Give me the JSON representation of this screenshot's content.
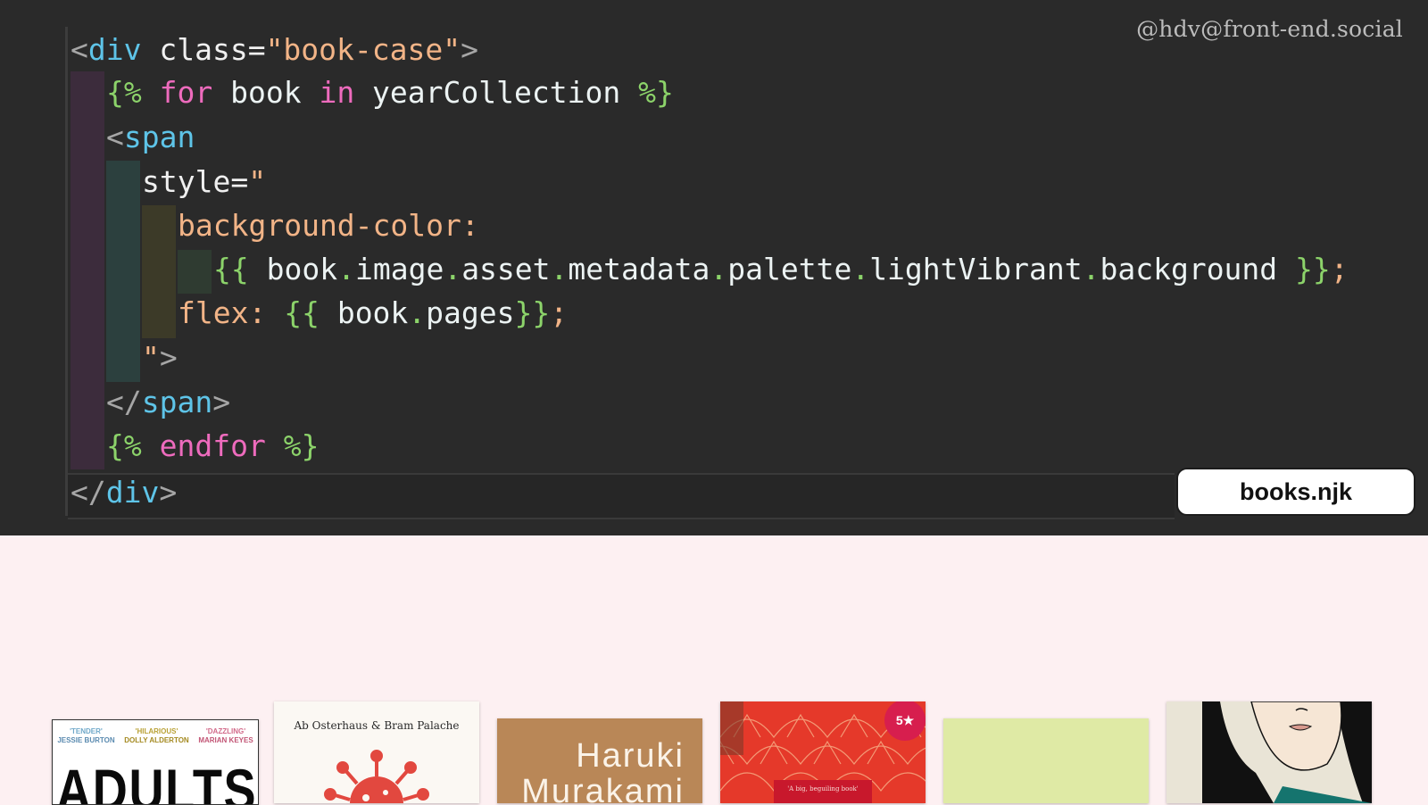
{
  "handle": "@hdv@front-end.social",
  "file_label": "books.njk",
  "code": {
    "l1": {
      "open": "<",
      "tag": "div",
      "attr": " class=",
      "val": "\"book-case\"",
      "close": ">"
    },
    "l2": {
      "open": "{%",
      "kw1": " for",
      "var1": " book",
      "kw2": " in",
      "var2": " yearCollection",
      "close": " %}"
    },
    "l3": {
      "open": "<",
      "tag": "span"
    },
    "l4": {
      "attr": "style=",
      "quote": "\""
    },
    "l5": {
      "prop": "background-color:"
    },
    "l6": {
      "open": "{{",
      "v0": " book",
      "d1": ".",
      "v1": "image",
      "d2": ".",
      "v2": "asset",
      "d3": ".",
      "v3": "metadata",
      "d4": ".",
      "v4": "palette",
      "d5": ".",
      "v5": "lightVibrant",
      "d6": ".",
      "v6": "background",
      "close": " }}",
      "semi": ";"
    },
    "l7": {
      "prop": "flex:",
      "open": " {{",
      "v0": " book",
      "d1": ".",
      "v1": "pages",
      "close": "}}",
      "semi": ";"
    },
    "l8": {
      "quote": "\"",
      "close": ">"
    },
    "l9": {
      "open": "</",
      "tag": "span",
      "close": ">"
    },
    "l10": {
      "open": "{%",
      "kw": " endfor",
      "close": " %}"
    },
    "l11": {
      "open": "</",
      "tag": "div",
      "close": ">"
    }
  },
  "books": {
    "book1": {
      "title": "ADULTS",
      "quotes": [
        {
          "quote": "'TENDER'",
          "author": "JESSIE BURTON",
          "color": "#6fa8c9"
        },
        {
          "quote": "'HILARIOUS'",
          "author": "DOLLY ALDERTON",
          "color": "#b9a135"
        },
        {
          "quote": "'DAZZLING'",
          "author": "MARIAN KEYES",
          "color": "#d26a8a"
        }
      ]
    },
    "book2": {
      "authors": "Ab Osterhaus & Bram Palache"
    },
    "book3": {
      "line1": "Haruki",
      "line2": "Murakami"
    },
    "book4": {
      "badge": "5★",
      "banner": "'A big, beguiling book'"
    },
    "colors": {
      "editor_bg": "#2a2a2a",
      "page_bg": "#fdf0f2",
      "tag": "#5ec4e8",
      "string": "#f2b487",
      "template": "#8cd36a",
      "keyword": "#ee6bbd"
    }
  }
}
